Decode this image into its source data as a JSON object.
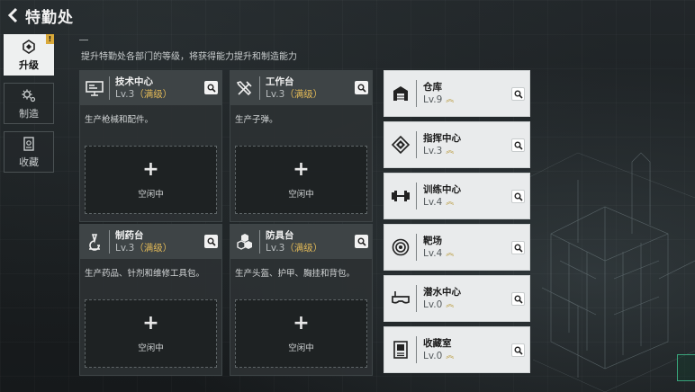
{
  "header": {
    "title": "特勤处",
    "back_icon": "back-arrow-icon"
  },
  "nav": {
    "items": [
      {
        "label": "升级",
        "icon": "upgrade-icon",
        "active": true,
        "badge": "!"
      },
      {
        "label": "制造",
        "icon": "gear-icon",
        "active": false
      },
      {
        "label": "收藏",
        "icon": "collection-icon",
        "active": false
      }
    ]
  },
  "description": "提升特勤处各部门的等级，将获得能力提升和制造能力",
  "production": [
    {
      "name": "技术中心",
      "level": "Lv.3",
      "status": "（满级）",
      "desc": "生产枪械和配件。",
      "slot": "空闲中",
      "plus": "+",
      "icon": "monitor-icon"
    },
    {
      "name": "工作台",
      "level": "Lv.3",
      "status": "（满级）",
      "desc": "生产子弹。",
      "slot": "空闲中",
      "plus": "+",
      "icon": "tools-icon"
    },
    {
      "name": "制药台",
      "level": "Lv.3",
      "status": "（满级）",
      "desc": "生产药品、针剂和维修工具包。",
      "slot": "空闲中",
      "plus": "+",
      "icon": "microscope-icon"
    },
    {
      "name": "防具台",
      "level": "Lv.3",
      "status": "（满级）",
      "desc": "生产头盔、护甲、胸挂和背包。",
      "slot": "空闲中",
      "plus": "+",
      "icon": "armor-icon"
    }
  ],
  "facilities": [
    {
      "name": "仓库",
      "level": "Lv.9",
      "icon": "warehouse-icon"
    },
    {
      "name": "指挥中心",
      "level": "Lv.3",
      "icon": "command-icon"
    },
    {
      "name": "训练中心",
      "level": "Lv.4",
      "icon": "dumbbell-icon"
    },
    {
      "name": "靶场",
      "level": "Lv.4",
      "icon": "target-icon"
    },
    {
      "name": "潜水中心",
      "level": "Lv.0",
      "icon": "diving-mask-icon"
    },
    {
      "name": "收藏室",
      "level": "Lv.0",
      "icon": "collection-room-icon"
    }
  ],
  "colors": {
    "accent_gold": "#e0b857",
    "badge": "#d9a93a",
    "panel": "#2c3133",
    "list_bg": "#e9ebec"
  }
}
